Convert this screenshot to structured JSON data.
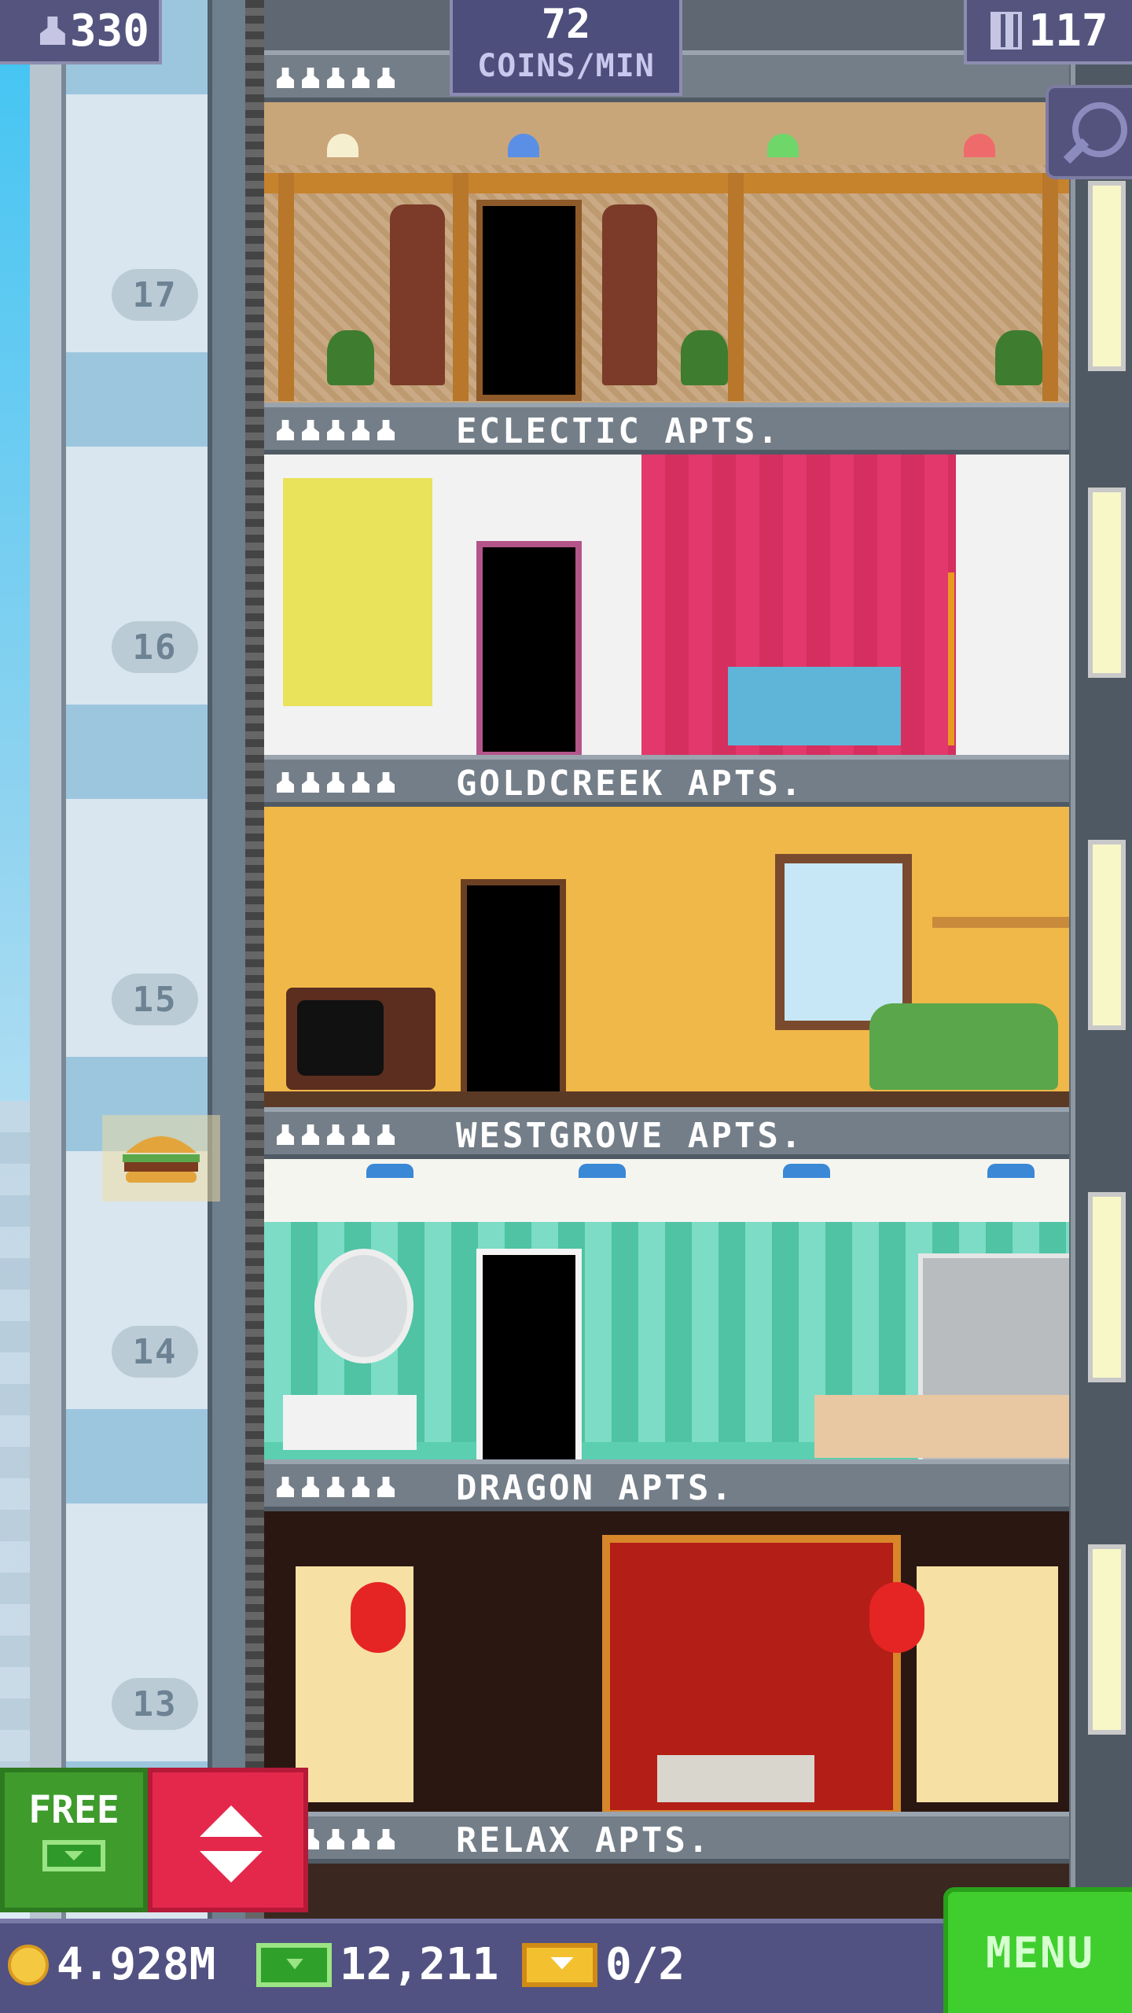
{
  "hud": {
    "population": "330",
    "coins_per_min_value": "72",
    "coins_per_min_label": "COINS/MIN",
    "floor_count": "117"
  },
  "floor_numbers": [
    "17",
    "16",
    "15",
    "14",
    "13"
  ],
  "floors": [
    {
      "name": "ECLECTIC APTS."
    },
    {
      "name": "GOLDCREEK APTS."
    },
    {
      "name": "WESTGROVE APTS."
    },
    {
      "name": "DRAGON APTS."
    },
    {
      "name": "RELAX APTS."
    }
  ],
  "buttons": {
    "free_label": "FREE",
    "menu_label": "MENU"
  },
  "currency": {
    "coins": "4.928M",
    "bux": "12,211",
    "tickets": "0/2"
  },
  "colors": {
    "hud_bg": "#54547f",
    "free_button": "#3e9b2c",
    "elevator_button": "#e4284b",
    "menu_button": "#3fce2e"
  },
  "icons": [
    "population-icon",
    "floors-icon",
    "search-icon",
    "bux-icon",
    "elevator-arrows-icon",
    "coin-icon",
    "ticket-icon"
  ]
}
